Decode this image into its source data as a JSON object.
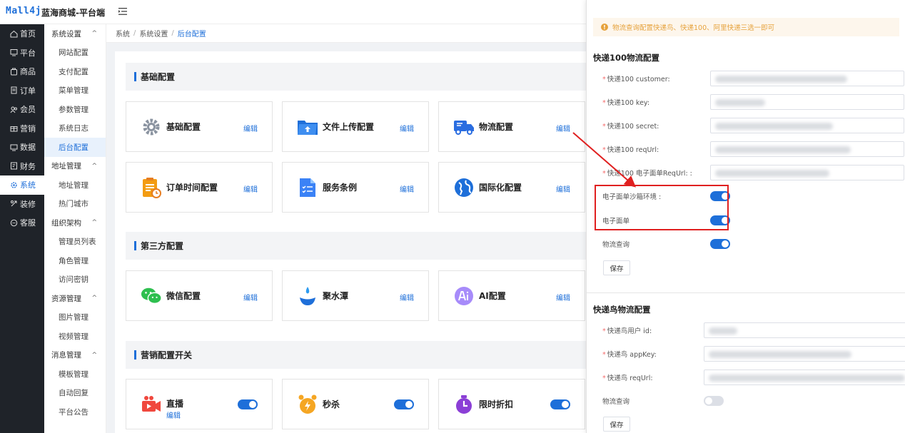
{
  "app": {
    "logo": "Mall4j",
    "title": "蓝海商城-平台端"
  },
  "nav": [
    {
      "label": "首页",
      "icon": "home-icon"
    },
    {
      "label": "平台",
      "icon": "monitor-icon"
    },
    {
      "label": "商品",
      "icon": "goods-icon"
    },
    {
      "label": "订单",
      "icon": "order-icon"
    },
    {
      "label": "会员",
      "icon": "member-icon"
    },
    {
      "label": "营销",
      "icon": "gift-icon"
    },
    {
      "label": "数据",
      "icon": "data-icon"
    },
    {
      "label": "财务",
      "icon": "finance-icon"
    },
    {
      "label": "系统",
      "icon": "gear-icon",
      "active": true
    },
    {
      "label": "装修",
      "icon": "decorate-icon"
    },
    {
      "label": "客服",
      "icon": "chat-icon"
    }
  ],
  "submenu": {
    "g1": "系统设置",
    "g1_items": [
      "网站配置",
      "支付配置",
      "菜单管理",
      "参数管理",
      "系统日志",
      "后台配置"
    ],
    "g2": "地址管理",
    "g2_items": [
      "地址管理",
      "热门城市"
    ],
    "g3": "组织架构",
    "g3_items": [
      "管理员列表",
      "角色管理",
      "访问密钥"
    ],
    "g4": "资源管理",
    "g4_items": [
      "图片管理",
      "视频管理"
    ],
    "g5": "消息管理",
    "g5_items": [
      "模板管理",
      "自动回复",
      "平台公告"
    ]
  },
  "breadcrumb": [
    "系统",
    "系统设置",
    "后台配置"
  ],
  "sections": {
    "basic": "基础配置",
    "third": "第三方配置",
    "marketing": "营销配置开关"
  },
  "cards": {
    "c1": "基础配置",
    "c2": "文件上传配置",
    "c3": "物流配置",
    "c4": "订单时间配置",
    "c5": "服务条例",
    "c6": "国际化配置",
    "c7": "微信配置",
    "c8": "聚水潭",
    "c9": "AI配置",
    "c10": "直播",
    "c11": "秒杀",
    "c12": "限时折扣",
    "edit": "编辑"
  },
  "toggles": {
    "live": true,
    "seckill": true,
    "discount": true
  },
  "drawer": {
    "alert": "物流查询配置快递鸟、快递100、阿里快递三选一即可",
    "kd100_title": "快递100物流配置",
    "kd100_fields": [
      "快递100 customer:",
      "快递100 key:",
      "快递100 secret:",
      "快递100 reqUrl:",
      "快递100 电子面单ReqUrl: :"
    ],
    "sandbox_label": "电子面单沙箱环境 :",
    "eorder_label": "电子面单",
    "query_label": "物流查询",
    "save": "保存",
    "kdn_title": "快递鸟物流配置",
    "kdn_fields": [
      "快递鸟用户 id:",
      "快递鸟 appKey:",
      "快递鸟 reqUrl:"
    ],
    "kdn_query_label": "物流查询",
    "switches": {
      "sandbox": true,
      "eorder": true,
      "kd100_query": true,
      "kdn_query": false
    }
  },
  "colors": {
    "brand": "#1e6fd9",
    "nav_bg": "#1f2329",
    "highlight": "#e02020",
    "warning": "#e6a23c"
  }
}
